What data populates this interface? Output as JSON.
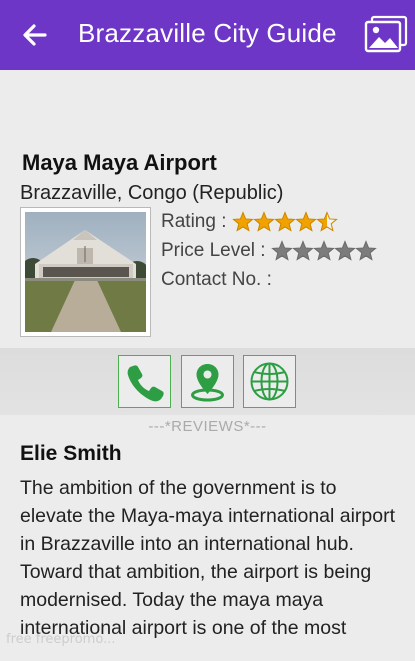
{
  "header": {
    "title": "Brazzaville City Guide",
    "back_icon": "arrow-left-icon",
    "gallery_icon": "image-gallery-icon",
    "bar_color": "#6d36c6"
  },
  "place": {
    "name": "Maya Maya Airport",
    "location": "Brazzaville, Congo (Republic)",
    "rating_label": "Rating :",
    "rating_value": 4.5,
    "rating_max": 5,
    "price_label": "Price Level :",
    "price_value": 0,
    "price_max": 5,
    "contact_label": "Contact No. :",
    "contact_value": ""
  },
  "actions": {
    "call_icon": "phone-icon",
    "map_icon": "map-pin-icon",
    "web_icon": "globe-icon",
    "accent": "#4caf50"
  },
  "reviews": {
    "header": "---*REVIEWS*---",
    "items": [
      {
        "author": "Elie Smith",
        "text": "The ambition of the government is to elevate the Maya-maya international airport in Brazzaville into an international hub. Toward that ambition, the airport is being modernised. Today the maya maya international airport is one of the most"
      }
    ]
  },
  "watermark": "free freepromo..."
}
